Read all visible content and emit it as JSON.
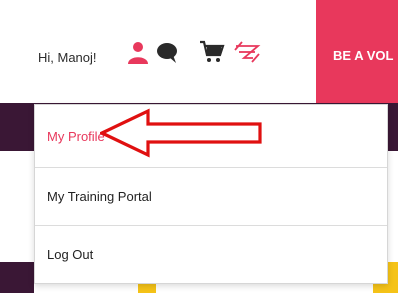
{
  "header": {
    "greeting": "Hi, Manoj!",
    "cta_label": "BE A VOL",
    "icons": [
      "user-icon",
      "chat-icon",
      "cart-icon",
      "brand-logo-icon"
    ]
  },
  "menu": {
    "items": [
      {
        "label": "My Profile",
        "highlighted": true
      },
      {
        "label": "My Training Portal",
        "highlighted": false
      },
      {
        "label": "Log Out",
        "highlighted": false
      }
    ]
  },
  "colors": {
    "accent": "#e8385c",
    "dark": "#3a1735",
    "yellow": "#f5c318"
  }
}
